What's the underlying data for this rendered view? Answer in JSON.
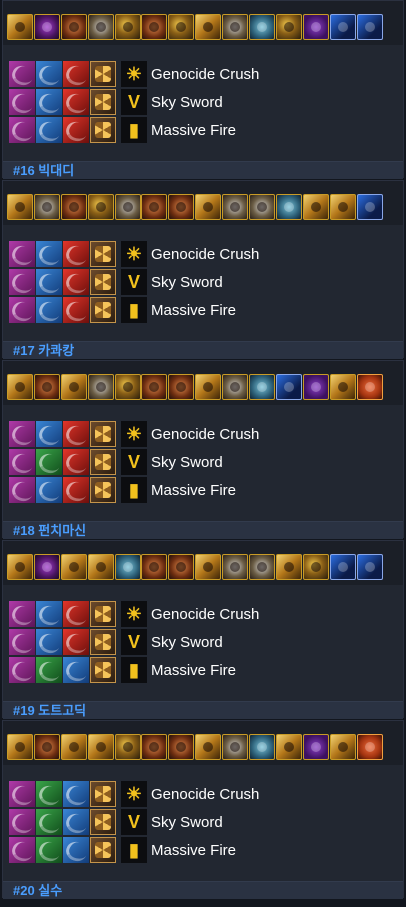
{
  "entries": [
    {
      "label": "#16 빅대디",
      "equipment": [
        "v6",
        "v1",
        "v5",
        "v2",
        "v0",
        "v5",
        "v0",
        "v6",
        "v2",
        "v7",
        "v0",
        "v4",
        "v3",
        "v3"
      ],
      "cores": [
        [
          "purple",
          "blue",
          "red"
        ],
        [
          "purple",
          "blue",
          "red"
        ],
        [
          "purple",
          "blue",
          "red"
        ]
      ],
      "skills": [
        {
          "icon": "☀",
          "name": "Genocide Crush"
        },
        {
          "icon": "V",
          "name": "Sky Sword"
        },
        {
          "icon": "▮",
          "name": "Massive Fire"
        }
      ]
    },
    {
      "label": "#17 카콰캉",
      "equipment": [
        "v6",
        "v2",
        "v5",
        "v0",
        "v2",
        "v5",
        "v5",
        "v6",
        "v2",
        "v2",
        "v7",
        "v6",
        "v6",
        "v3"
      ],
      "cores": [
        [
          "purple",
          "blue",
          "red"
        ],
        [
          "purple",
          "blue",
          "red"
        ],
        [
          "purple",
          "blue",
          "red"
        ]
      ],
      "skills": [
        {
          "icon": "☀",
          "name": "Genocide Crush"
        },
        {
          "icon": "V",
          "name": "Sky Sword"
        },
        {
          "icon": "▮",
          "name": "Massive Fire"
        }
      ]
    },
    {
      "label": "#18 펀치마신",
      "equipment": [
        "v6",
        "v5",
        "v6",
        "v2",
        "v0",
        "v5",
        "v5",
        "v6",
        "v2",
        "v7",
        "v3",
        "v4",
        "v6",
        "v8"
      ],
      "cores": [
        [
          "purple",
          "blue",
          "red"
        ],
        [
          "purple",
          "green",
          "red"
        ],
        [
          "purple",
          "blue",
          "red"
        ]
      ],
      "skills": [
        {
          "icon": "☀",
          "name": "Genocide Crush"
        },
        {
          "icon": "V",
          "name": "Sky Sword"
        },
        {
          "icon": "▮",
          "name": "Massive Fire"
        }
      ]
    },
    {
      "label": "#19 도트고딕",
      "equipment": [
        "v6",
        "v1",
        "v6",
        "v6",
        "v7",
        "v5",
        "v5",
        "v6",
        "v2",
        "v2",
        "v6",
        "v0",
        "v3",
        "v3"
      ],
      "cores": [
        [
          "purple",
          "blue",
          "red"
        ],
        [
          "purple",
          "blue",
          "red"
        ],
        [
          "purple",
          "green",
          "blue"
        ]
      ],
      "skills": [
        {
          "icon": "☀",
          "name": "Genocide Crush"
        },
        {
          "icon": "V",
          "name": "Sky Sword"
        },
        {
          "icon": "▮",
          "name": "Massive Fire"
        }
      ]
    },
    {
      "label": "#20 실수",
      "equipment": [
        "v6",
        "v5",
        "v6",
        "v6",
        "v0",
        "v5",
        "v5",
        "v6",
        "v2",
        "v7",
        "v6",
        "v4",
        "v6",
        "v8"
      ],
      "cores": [
        [
          "purple",
          "green",
          "blue"
        ],
        [
          "purple",
          "green",
          "blue"
        ],
        [
          "purple",
          "green",
          "blue"
        ]
      ],
      "skills": [
        {
          "icon": "☀",
          "name": "Genocide Crush"
        },
        {
          "icon": "V",
          "name": "Sky Sword"
        },
        {
          "icon": "▮",
          "name": "Massive Fire"
        }
      ]
    }
  ]
}
